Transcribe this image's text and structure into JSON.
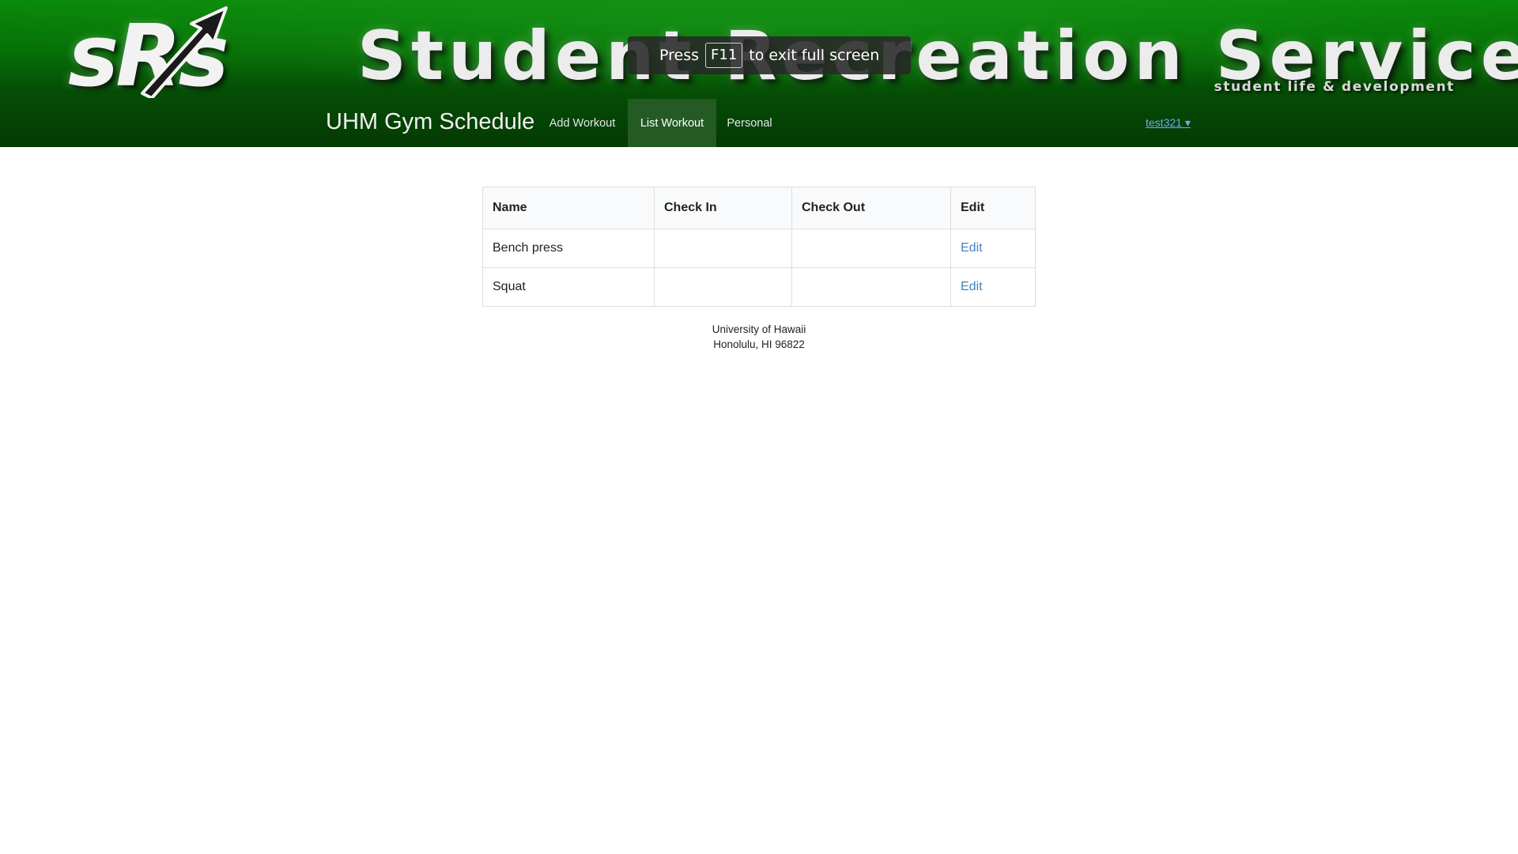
{
  "banner": {
    "logo_text": "sRs",
    "title": "Student Recreation Services",
    "tagline": "student life & development"
  },
  "fullscreen_notice": {
    "prefix": "Press",
    "key": "F11",
    "suffix": "to exit full screen"
  },
  "navbar": {
    "brand": "UHM Gym Schedule",
    "items": [
      {
        "label": "Add Workout",
        "active": false
      },
      {
        "label": "List Workout",
        "active": true
      },
      {
        "label": "Personal",
        "active": false
      }
    ],
    "user": "test321 ▾"
  },
  "table": {
    "headers": [
      "Name",
      "Check In",
      "Check Out",
      "Edit"
    ],
    "rows": [
      {
        "name": "Bench press",
        "check_in": "",
        "check_out": "",
        "edit": "Edit"
      },
      {
        "name": "Squat",
        "check_in": "",
        "check_out": "",
        "edit": "Edit"
      }
    ]
  },
  "footer": {
    "line1": "University of Hawaii",
    "line2": "Honolulu, HI 96822"
  },
  "colors": {
    "banner_green": "#077007",
    "nav_active": "#245a24",
    "link_blue": "#4183c4",
    "user_link": "#6ea9ff"
  }
}
